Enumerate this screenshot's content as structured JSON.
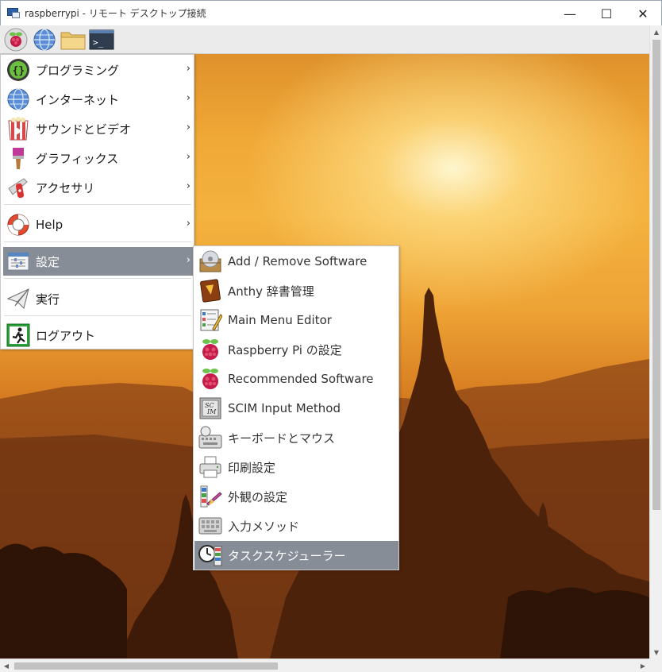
{
  "window": {
    "title": "raspberrypi - リモート デスクトップ接続",
    "minimize": "—",
    "maximize": "☐",
    "close": "✕"
  },
  "panel": {
    "buttons": [
      "raspberry-menu-icon",
      "web-browser-icon",
      "file-manager-icon",
      "terminal-icon"
    ],
    "terminal_glyph": ">_"
  },
  "menu": {
    "chevron": "›",
    "items": [
      {
        "label": "プログラミング",
        "icon": "programming-icon",
        "has_submenu": true
      },
      {
        "label": "インターネット",
        "icon": "internet-globe-icon",
        "has_submenu": true
      },
      {
        "label": "サウンドとビデオ",
        "icon": "sound-video-icon",
        "has_submenu": true
      },
      {
        "label": "グラフィックス",
        "icon": "graphics-brush-icon",
        "has_submenu": true
      },
      {
        "label": "アクセサリ",
        "icon": "accessories-knife-icon",
        "has_submenu": true
      },
      {
        "label": "Help",
        "icon": "help-lifebuoy-icon",
        "has_submenu": true
      },
      {
        "label": "設定",
        "icon": "preferences-icon",
        "has_submenu": true,
        "selected": true
      },
      {
        "label": "実行",
        "icon": "run-paperplane-icon",
        "has_submenu": false
      },
      {
        "label": "ログアウト",
        "icon": "logout-exit-icon",
        "has_submenu": false
      }
    ]
  },
  "submenu": {
    "items": [
      {
        "label": "Add / Remove Software",
        "icon": "add-remove-software-icon"
      },
      {
        "label": "Anthy 辞書管理",
        "icon": "anthy-dictionary-icon"
      },
      {
        "label": "Main Menu Editor",
        "icon": "main-menu-editor-icon"
      },
      {
        "label": "Raspberry Pi の設定",
        "icon": "raspberry-config-icon"
      },
      {
        "label": "Recommended Software",
        "icon": "raspberry-recommended-icon"
      },
      {
        "label": "SCIM Input Method",
        "icon": "scim-icon"
      },
      {
        "label": "キーボードとマウス",
        "icon": "keyboard-mouse-icon"
      },
      {
        "label": "印刷設定",
        "icon": "printer-icon"
      },
      {
        "label": "外観の設定",
        "icon": "appearance-icon"
      },
      {
        "label": "入力メソッド",
        "icon": "input-method-keyboard-icon"
      },
      {
        "label": "タスクスケジューラー",
        "icon": "task-scheduler-clock-icon",
        "selected": true
      }
    ]
  },
  "colors": {
    "selection": "#868d96",
    "panel": "#ebebeb",
    "raspberry": "#c51a4a"
  }
}
